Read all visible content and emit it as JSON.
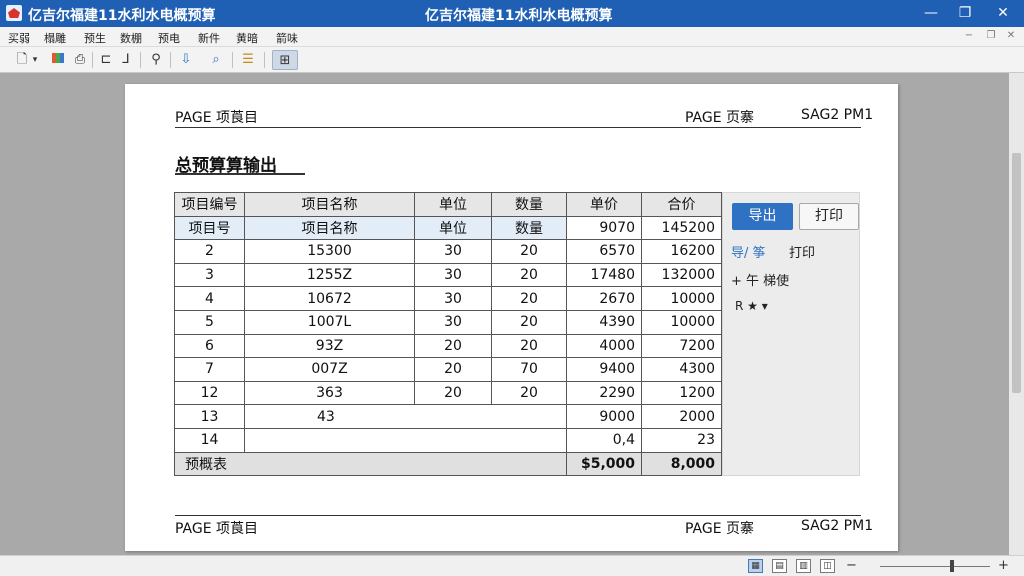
{
  "window": {
    "title_left": "亿吉尔福建11水利水电概预算",
    "title_center": "亿吉尔福建11水利水电概预算",
    "minimize": "—",
    "restore": "❐",
    "close": "✕"
  },
  "menu": {
    "items": [
      "买弱",
      "榻雕",
      "预生",
      "数棚",
      "预电",
      "新件",
      "黄暗",
      "箭味"
    ]
  },
  "page": {
    "header_left": "PAGE  项莨目",
    "header_mid": "PAGE  页寨",
    "header_right": "SAG2 PM1",
    "title": "总预算算输出",
    "footer_left": "PAGE  项莨目",
    "footer_mid": "PAGE  页寨",
    "footer_right": "SAG2 PM1"
  },
  "table": {
    "headers": [
      "项目编号",
      "项目名称",
      "单位",
      "数量",
      "单价",
      "合价"
    ],
    "subheader": [
      "项目号",
      "项目名称",
      "单位",
      "数量",
      "9070",
      "145200"
    ],
    "rows": [
      [
        "2",
        "15300",
        "30",
        "20",
        "6570",
        "16200"
      ],
      [
        "3",
        "1255Z",
        "30",
        "20",
        "17480",
        "132000"
      ],
      [
        "4",
        "10672",
        "30",
        "20",
        "2670",
        "10000"
      ],
      [
        "5",
        "1007L",
        "30",
        "20",
        "4390",
        "10000"
      ],
      [
        "6",
        "93Z",
        "20",
        "20",
        "4000",
        "7200"
      ],
      [
        "7",
        "007Z",
        "20",
        "70",
        "9400",
        "4300"
      ],
      [
        "12",
        "363",
        "20",
        "20",
        "2290",
        "1200"
      ],
      [
        "13",
        "43",
        "",
        "",
        "9000",
        "2000"
      ],
      [
        "14",
        "",
        "",
        "",
        "0,4",
        "23"
      ]
    ],
    "total": [
      "预概表",
      "$5,000",
      "8,000"
    ]
  },
  "side_panel": {
    "export_button": "导出",
    "print_button": "打印",
    "link_export": "导/ 筝",
    "link_print": "打印",
    "link_add": "+ 午 梯使",
    "link_filter": "R ★ ▾"
  },
  "colors": {
    "titlebar": "#1f5fb4",
    "primary_button": "#2f72c4",
    "highlight_row": "#e3edf8"
  }
}
